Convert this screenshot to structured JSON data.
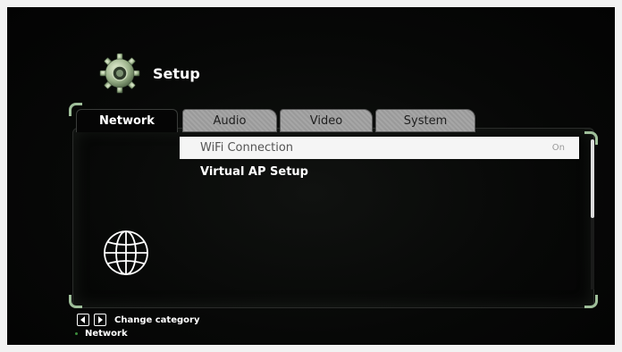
{
  "header": {
    "title": "Setup",
    "icon": "gear-icon"
  },
  "tabs": [
    {
      "label": "Network",
      "active": true
    },
    {
      "label": "Audio",
      "active": false
    },
    {
      "label": "Video",
      "active": false
    },
    {
      "label": "System",
      "active": false
    }
  ],
  "menu": {
    "items": [
      {
        "label": "WiFi Connection",
        "value": "On",
        "selected": true
      },
      {
        "label": "Virtual AP Setup",
        "value": "",
        "selected": false
      }
    ]
  },
  "category_icon": "globe-icon",
  "footer": {
    "hint_label": "Change category",
    "current_category": "Network",
    "icons": [
      "arrow-left-icon",
      "arrow-right-icon"
    ]
  },
  "colors": {
    "background": "#070807",
    "selected_row": "#f5f5f5",
    "accent_green": "#9fbf9a",
    "tab_inactive": "#a0a0a0"
  }
}
